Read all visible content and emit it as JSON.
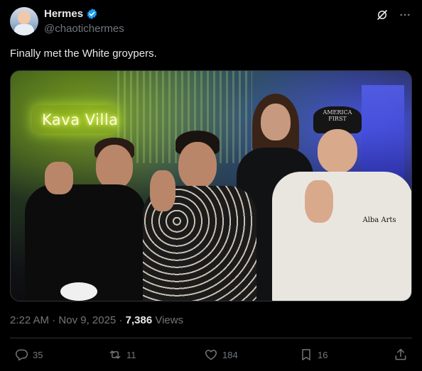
{
  "author": {
    "display_name": "Hermes",
    "handle": "@chaotichermes",
    "verified": true
  },
  "tweet": {
    "text": "Finally met the White groypers."
  },
  "media": {
    "neon_sign": "Kava Villa",
    "cap_text": "AMERICA FIRST",
    "shirt_text": "Alba Arts"
  },
  "meta": {
    "time": "2:22 AM",
    "separator": " · ",
    "date": "Nov 9, 2025",
    "views_count": "7,386",
    "views_label": " Views"
  },
  "actions": {
    "replies": "35",
    "reposts": "11",
    "likes": "184",
    "bookmarks": "16"
  },
  "colors": {
    "background": "#000000",
    "text": "#e7e9ea",
    "muted": "#71767b",
    "verified": "#1d9bf0",
    "divider": "#2f3336"
  }
}
